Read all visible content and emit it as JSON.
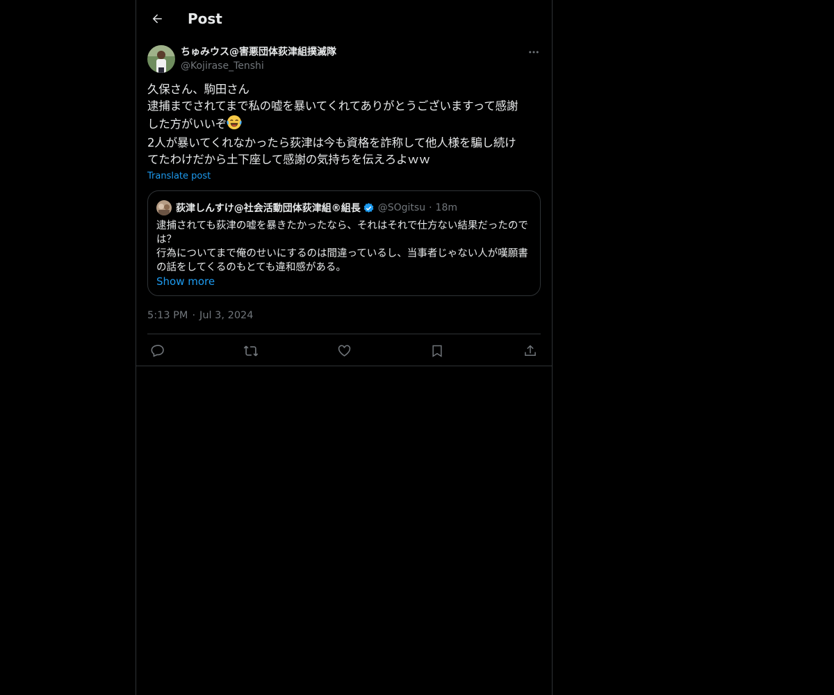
{
  "header": {
    "title": "Post",
    "back_icon": "arrow-left-icon"
  },
  "post": {
    "author": {
      "display_name": "ちゅみウス@害悪団体荻津組撲滅隊",
      "handle": "@Kojirase_Tenshi",
      "avatar_icon": "avatar"
    },
    "text_lines": [
      "久保さん、駒田さん",
      "逮捕までされてまで私の嘘を暴いてくれてありがとうございますって感謝",
      "した方がいいぞ",
      "2人が暴いてくれなかったら荻津は今も資格を詐称して他人様を騙し続け",
      "てたわけだから土下座して感謝の気持ちを伝えろよｗｗ"
    ],
    "emoji": "😂",
    "translate_label": "Translate post",
    "quote": {
      "display_name": "荻津しんすけ@社会活動団体荻津組®組長",
      "handle": "@SOgitsu",
      "separator": "·",
      "time": "18m",
      "text": "逮捕されても荻津の嘘を暴きたかったなら、それはそれで仕方ない結果だったのでは？\n行為についてまで俺のせいにするのは間違っているし、当事者じゃない人が嘆願書の話をしてくるのもとても違和感がある。",
      "show_more_label": "Show more"
    },
    "time": "5:13 PM",
    "separator": "·",
    "date": "Jul 3, 2024"
  },
  "actions": [
    {
      "name": "reply-icon"
    },
    {
      "name": "repost-icon"
    },
    {
      "name": "like-icon"
    },
    {
      "name": "bookmark-icon"
    },
    {
      "name": "share-icon"
    }
  ],
  "colors": {
    "background": "#000000",
    "text": "#e7e9ea",
    "muted": "#71767b",
    "accent": "#1d9bf0",
    "border": "#2f3336"
  }
}
